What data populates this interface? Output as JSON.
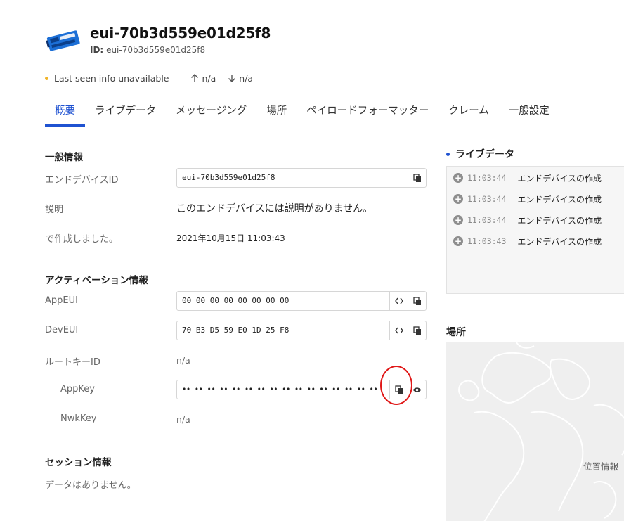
{
  "device": {
    "title": "eui-70b3d559e01d25f8",
    "id_label": "ID:",
    "id_value": "eui-70b3d559e01d25f8"
  },
  "status": {
    "last_seen": "Last seen info unavailable",
    "uplink": "n/a",
    "downlink": "n/a",
    "indicator_color": "#f0b429"
  },
  "tabs": [
    {
      "label": "概要",
      "active": true
    },
    {
      "label": "ライブデータ"
    },
    {
      "label": "メッセージング"
    },
    {
      "label": "場所"
    },
    {
      "label": "ペイロードフォーマッター"
    },
    {
      "label": "クレーム"
    },
    {
      "label": "一般設定"
    }
  ],
  "general": {
    "title": "一般情報",
    "device_id_label": "エンドデバイスID",
    "device_id_value": "eui-70b3d559e01d25f8",
    "desc_label": "説明",
    "desc_value": "このエンドデバイスには説明がありません。",
    "created_label": "で作成しました。",
    "created_value": "2021年10月15日 11:03:43"
  },
  "activation": {
    "title": "アクティベーション情報",
    "appeui_label": "AppEUI",
    "appeui_value": "00 00 00 00 00 00 00 00",
    "deveui_label": "DevEUI",
    "deveui_value": "70 B3 D5 59 E0 1D 25 F8",
    "rootkey_label": "ルートキーID",
    "rootkey_value": "n/a",
    "appkey_label": "AppKey",
    "appkey_value": "•• •• •• •• •• •• •• •• •• •• •• •• •• •• •• ••",
    "nwkkey_label": "NwkKey",
    "nwkkey_value": "n/a"
  },
  "session": {
    "title": "セッション情報",
    "empty": "データはありません。"
  },
  "live": {
    "title": "ライブデータ",
    "events": [
      {
        "time": "11:03:44",
        "text": "エンドデバイスの作成"
      },
      {
        "time": "11:03:44",
        "text": "エンドデバイスの作成"
      },
      {
        "time": "11:03:44",
        "text": "エンドデバイスの作成"
      },
      {
        "time": "11:03:43",
        "text": "エンドデバイスの作成"
      }
    ]
  },
  "location": {
    "title": "場所",
    "map_label": "位置情報"
  },
  "colors": {
    "accent": "#1f52d1",
    "annotation": "#e01818"
  },
  "icons": {
    "device": "device-board-icon",
    "copy": "copy-icon",
    "code": "code-brackets-icon",
    "eye": "eye-icon",
    "up": "arrow-up-icon",
    "down": "arrow-down-icon",
    "plus": "plus-circle-icon"
  }
}
